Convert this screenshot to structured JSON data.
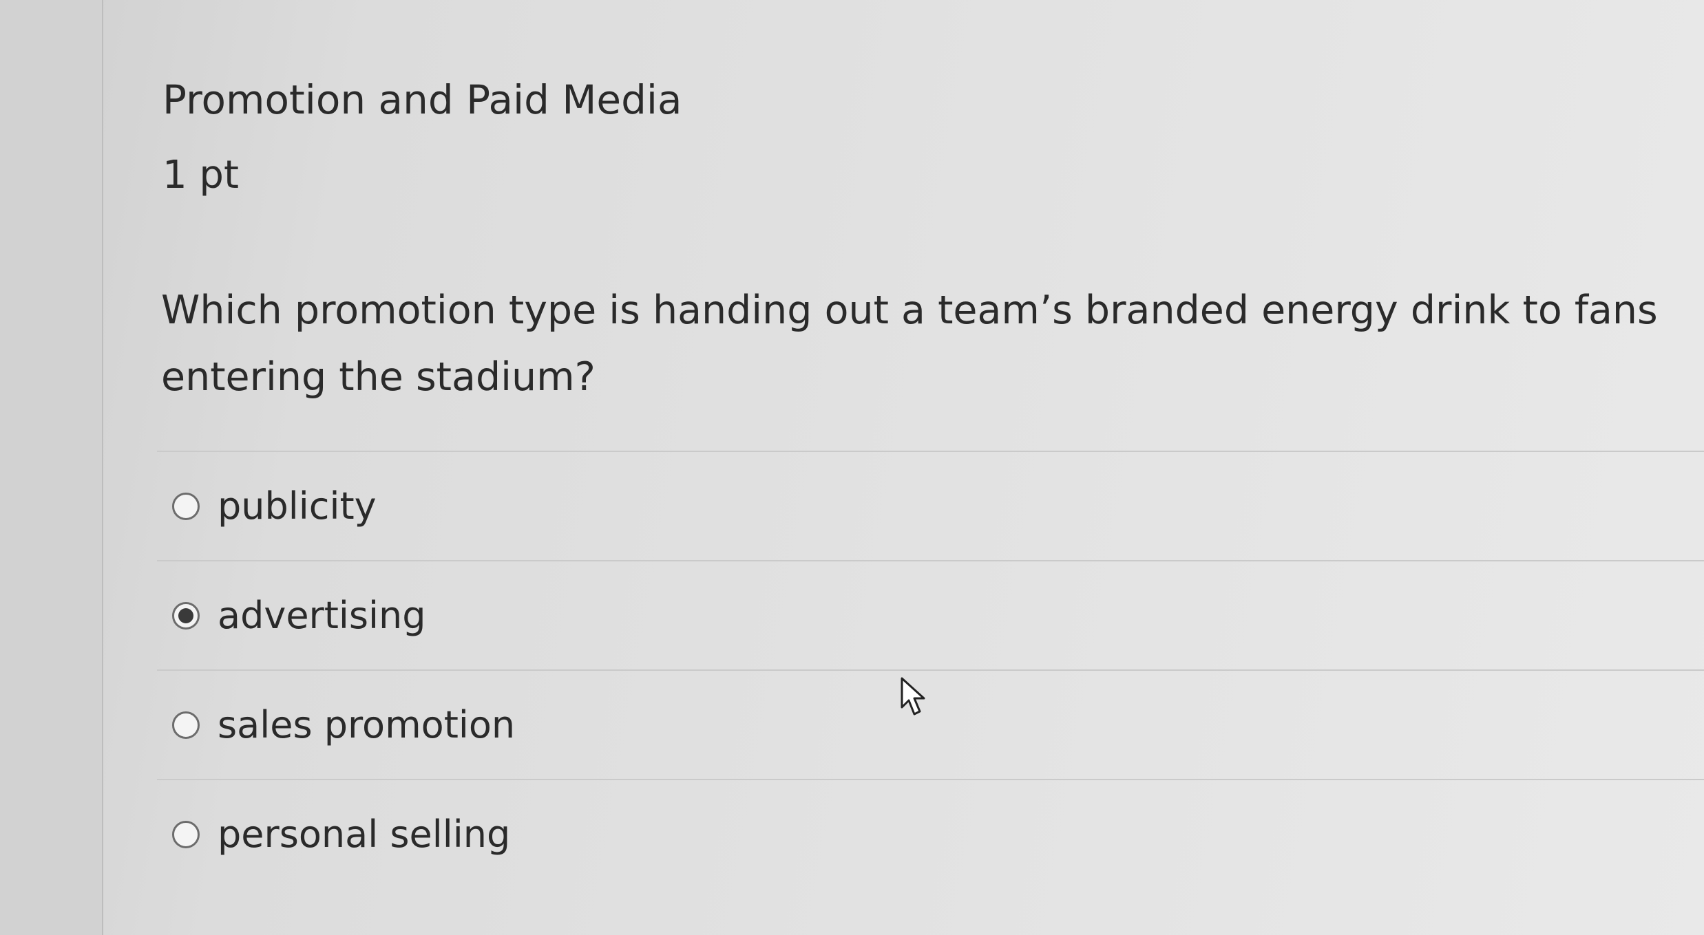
{
  "question": {
    "title": "Promotion and Paid Media",
    "points": "1 pt",
    "text": "Which promotion type is handing out a team’s branded energy drink to fans entering the stadium?"
  },
  "answers": [
    {
      "label": "publicity",
      "selected": false
    },
    {
      "label": "advertising",
      "selected": true
    },
    {
      "label": "sales promotion",
      "selected": false
    },
    {
      "label": "personal selling",
      "selected": false
    }
  ],
  "icons": {
    "radio_unselected": "radio-empty-icon",
    "radio_selected": "radio-filled-icon",
    "cursor": "mouse-pointer-icon"
  }
}
